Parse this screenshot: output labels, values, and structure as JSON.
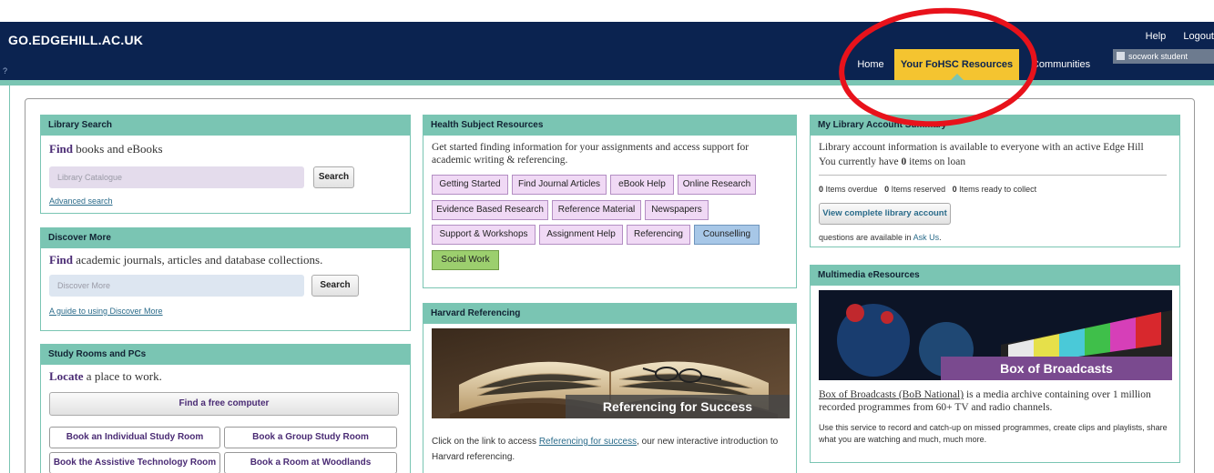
{
  "header": {
    "brand": "GO.EDGEHILL.AC.UK",
    "mark": "?",
    "help": "Help",
    "logout": "Logout",
    "user": "socwork student"
  },
  "nav": {
    "home": "Home",
    "resources": "Your FoHSC Resources",
    "communities": "Communities"
  },
  "library_search": {
    "title": "Library Search",
    "find_bold": "Find",
    "find_rest": " books and eBooks",
    "placeholder": "Library Catalogue",
    "button": "Search",
    "advanced": "Advanced search"
  },
  "discover": {
    "title": "Discover More",
    "find_bold": "Find",
    "find_rest": " academic journals, articles and database collections.",
    "placeholder": "Discover More",
    "button": "Search",
    "guide": "A guide to using Discover More"
  },
  "study_rooms": {
    "title": "Study Rooms and PCs",
    "locate_bold": "Locate",
    "locate_rest": " a place to work.",
    "free_computer": "Find a free computer",
    "individual": "Book an Individual Study Room",
    "group": "Book a Group Study Room",
    "assistive": "Book the Assistive Technology Room",
    "woodlands": "Book a Room at Woodlands"
  },
  "health": {
    "title": "Health Subject Resources",
    "intro": "Get started finding information for your assignments and access support for academic writing & referencing.",
    "tags": [
      "Getting Started",
      "Find Journal Articles",
      "eBook Help",
      "Online Research",
      "Evidence Based Research",
      "Reference Material",
      "Newspapers",
      "Support & Workshops",
      "Assignment Help",
      "Referencing",
      "Counselling",
      "Social Work"
    ]
  },
  "harvard": {
    "title": "Harvard Referencing",
    "banner_text": "Referencing for Success",
    "text_before": "Click on the link to access ",
    "link": "Referencing for success",
    "text_after": ", our new interactive introduction to Harvard referencing."
  },
  "account": {
    "title": "My Library Account Summary",
    "info": "Library account information is available to everyone with an active Edge Hill",
    "loan_before": "You currently have ",
    "loan_count": "0",
    "loan_after": " items on loan",
    "overdue_n": "0",
    "overdue": " Items overdue",
    "reserved_n": "0",
    "reserved": " Items reserved",
    "ready_n": "0",
    "ready": " Items ready to collect",
    "view_button": "View complete library account",
    "questions": "questions are available in ",
    "ask_us": "Ask Us",
    "questions_end": "."
  },
  "multimedia": {
    "title": "Multimedia eResources",
    "banner_text": "Box of Broadcasts",
    "link": "Box of Broadcasts (BoB National)",
    "desc": " is a media archive containing over 1 million recorded programmes from 60+ TV and radio channels.",
    "use": "Use this service to record and catch-up on missed programmes, create clips and playlists, share what you are watching and much, much more."
  },
  "colors": {
    "navy": "#0b2350",
    "teal": "#7ac5b3",
    "active_tab": "#f4c430",
    "annotation": "#e8121b",
    "tag_pink": "#f0d9f5",
    "tag_blue": "#a7c7e7",
    "tag_green": "#9ccf6e"
  }
}
